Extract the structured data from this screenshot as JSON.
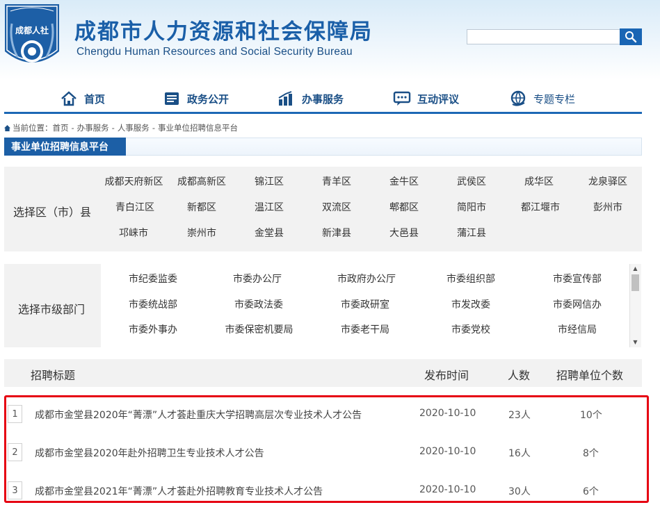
{
  "header": {
    "logo_text": "成都人社",
    "title": "成都市人力资源和社会保障局",
    "subtitle": "Chengdu Human Resources and Social Security Bureau",
    "search": {
      "value": "",
      "placeholder": ""
    }
  },
  "nav": [
    {
      "label": "首页",
      "icon": "home-icon"
    },
    {
      "label": "政务公开",
      "icon": "document-icon"
    },
    {
      "label": "办事服务",
      "icon": "bar-chart-icon"
    },
    {
      "label": "互动评议",
      "icon": "chat-icon"
    },
    {
      "label": "专题专栏",
      "icon": "globe-icon"
    }
  ],
  "breadcrumb": {
    "prefix": "当前位置：",
    "items": [
      "首页",
      "办事服务",
      "人事服务",
      "事业单位招聘信息平台"
    ],
    "sep": "-"
  },
  "section_title": "事业单位招聘信息平台",
  "district_panel": {
    "label": "选择区（市）县",
    "items": [
      "成都天府新区",
      "成都高新区",
      "锦江区",
      "青羊区",
      "金牛区",
      "武侯区",
      "成华区",
      "龙泉驿区",
      "青白江区",
      "新都区",
      "温江区",
      "双流区",
      "郫都区",
      "简阳市",
      "都江堰市",
      "彭州市",
      "邛崃市",
      "崇州市",
      "金堂县",
      "新津县",
      "大邑县",
      "蒲江县"
    ]
  },
  "department_panel": {
    "label": "选择市级部门",
    "items": [
      "市纪委监委",
      "市委办公厅",
      "市政府办公厅",
      "市委组织部",
      "市委宣传部",
      "市委统战部",
      "市委政法委",
      "市委政研室",
      "市发改委",
      "市委网信办",
      "市委外事办",
      "市委保密机要局",
      "市委老干局",
      "市委党校",
      "市经信局"
    ]
  },
  "table": {
    "headers": {
      "title": "招聘标题",
      "date": "发布时间",
      "count": "人数",
      "units": "招聘单位个数"
    },
    "rows": [
      {
        "num": "1",
        "title": "成都市金堂县2020年“菁漂”人才荟赴重庆大学招聘高层次专业技术人才公告",
        "date": "2020-10-10",
        "count": "23人",
        "units": "10个"
      },
      {
        "num": "2",
        "title": "成都市金堂县2020年赴外招聘卫生专业技术人才公告",
        "date": "2020-10-10",
        "count": "16人",
        "units": "8个"
      },
      {
        "num": "3",
        "title": "成都市金堂县2021年“菁漂”人才荟赴外招聘教育专业技术人才公告",
        "date": "2020-10-10",
        "count": "30人",
        "units": "6个"
      }
    ]
  },
  "colors": {
    "brand_blue": "#1a5fa8",
    "nav_line": "#1c68b5",
    "highlight_red": "#e60012"
  }
}
